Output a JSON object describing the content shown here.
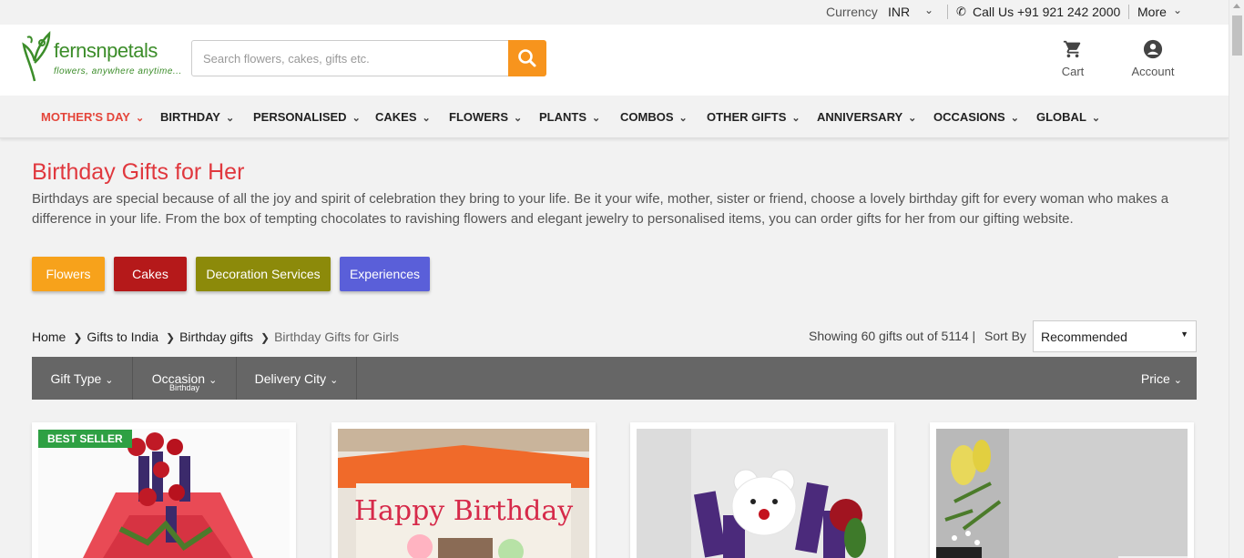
{
  "topbar": {
    "currency_label": "Currency",
    "currency_value": "INR",
    "call_text": "Call Us +91 921 242 2000",
    "more_label": "More"
  },
  "header": {
    "logo_brand": "fernsnpetals",
    "logo_tagline": "flowers, anywhere anytime...",
    "search_placeholder": "Search flowers, cakes, gifts etc.",
    "cart_label": "Cart",
    "account_label": "Account"
  },
  "nav": [
    {
      "label": "MOTHER'S DAY",
      "active": true
    },
    {
      "label": "BIRTHDAY"
    },
    {
      "label": "PERSONALISED"
    },
    {
      "label": "CAKES"
    },
    {
      "label": "FLOWERS"
    },
    {
      "label": "PLANTS"
    },
    {
      "label": "COMBOS"
    },
    {
      "label": "OTHER GIFTS"
    },
    {
      "label": "ANNIVERSARY"
    },
    {
      "label": "OCCASIONS"
    },
    {
      "label": "GLOBAL"
    }
  ],
  "page": {
    "title": "Birthday Gifts for Her",
    "description": "Birthdays are special because of all the joy and spirit of celebration they bring to your life. Be it your wife, mother, sister or friend, choose a lovely birthday gift for every woman who makes a difference in your life. From the box of tempting chocolates to ravishing flowers and elegant jewelry to personalised items, you can order gifts for her from our gifting website."
  },
  "chips": [
    {
      "label": "Flowers",
      "color": "#f7a21b"
    },
    {
      "label": "Cakes",
      "color": "#b5191a"
    },
    {
      "label": "Decoration Services",
      "color": "#8c8a0a"
    },
    {
      "label": "Experiences",
      "color": "#5a5fd9"
    }
  ],
  "breadcrumb": [
    "Home",
    "Gifts to India",
    "Birthday gifts",
    "Birthday Gifts for Girls"
  ],
  "results": {
    "showing_text": "Showing 60 gifts out of 5114 |",
    "sort_label": "Sort By",
    "sort_value": "Recommended"
  },
  "filters": {
    "gift_type": "Gift Type",
    "occasion": "Occasion",
    "occasion_sub": "Birthday",
    "delivery_city": "Delivery City",
    "price": "Price"
  },
  "products": {
    "badge": "BEST SELLER",
    "card2_text": "Happy Birthday"
  },
  "colors": {
    "accent_red": "#e0383e",
    "search_orange": "#f7941d",
    "filter_bar": "#666666",
    "badge_green": "#2ea043"
  }
}
